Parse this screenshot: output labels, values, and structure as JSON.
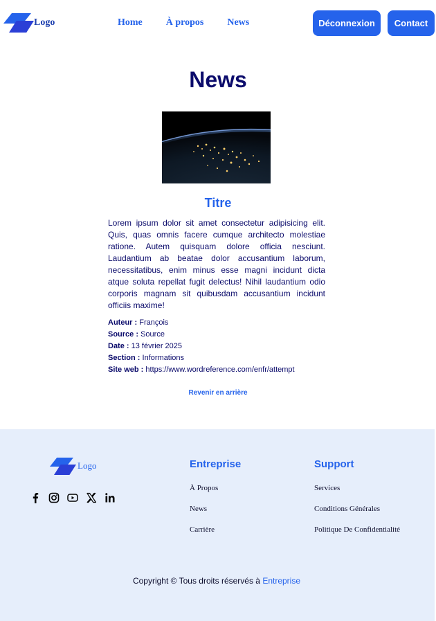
{
  "header": {
    "logo_text": "Logo",
    "nav": [
      "Home",
      "À propos",
      "News"
    ],
    "logout_label": "Déconnexion",
    "contact_label": "Contact"
  },
  "main": {
    "page_title": "News",
    "article": {
      "title": "Titre",
      "body": "Lorem ipsum dolor sit amet consectetur adipisicing elit. Quis, quas omnis facere cumque architecto molestiae ratione. Autem quisquam dolore officia nesciunt. Laudantium ab beatae dolor accusantium laborum, necessitatibus, enim minus esse magni incidunt dicta atque soluta repellat fugit delectus! Nihil laudantium odio corporis magnam sit quibusdam accusantium incidunt officiis maxime!",
      "meta": [
        {
          "label": "Auteur :",
          "value": "François"
        },
        {
          "label": "Source :",
          "value": "Source"
        },
        {
          "label": "Date :",
          "value": "13 février 2025"
        },
        {
          "label": "Section :",
          "value": "Informations"
        },
        {
          "label": "Site web :",
          "value": "https://www.wordreference.com/enfr/attempt"
        }
      ]
    },
    "back_label": "Revenir en arrière"
  },
  "footer": {
    "logo_text": "Logo",
    "socials": [
      "facebook-icon",
      "instagram-icon",
      "youtube-icon",
      "x-icon",
      "linkedin-icon"
    ],
    "columns": [
      {
        "title": "Entreprise",
        "links": [
          "À Propos",
          "News",
          "Carrière"
        ]
      },
      {
        "title": "Support",
        "links": [
          "Services",
          "Conditions Générales",
          "Politique De Confidentialité"
        ]
      }
    ],
    "copyright_text": "Copyright © Tous droits réservés à",
    "copyright_brand": "Entreprise"
  },
  "colors": {
    "accent": "#2563eb",
    "title": "#0b0b6b",
    "footer_bg": "#e6eefb"
  }
}
